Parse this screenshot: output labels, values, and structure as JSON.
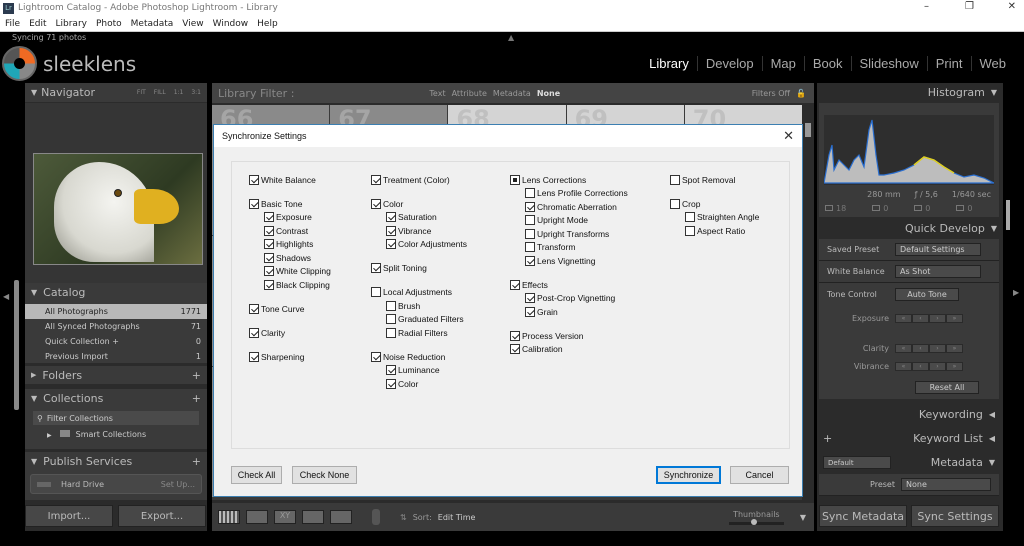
{
  "window": {
    "title": "Lightroom Catalog - Adobe Photoshop Lightroom - Library",
    "app_icon": "Lr"
  },
  "menu": [
    "File",
    "Edit",
    "Library",
    "Photo",
    "Metadata",
    "View",
    "Window",
    "Help"
  ],
  "status": "Syncing 71 photos",
  "logo": "sleeklens",
  "modules": [
    "Library",
    "Develop",
    "Map",
    "Book",
    "Slideshow",
    "Print",
    "Web"
  ],
  "left": {
    "navigator": {
      "title": "Navigator",
      "zoom": [
        "FIT",
        "FILL",
        "1:1",
        "3:1"
      ]
    },
    "catalog": {
      "title": "Catalog",
      "items": [
        {
          "label": "All Photographs",
          "count": "1771"
        },
        {
          "label": "All Synced Photographs",
          "count": "71"
        },
        {
          "label": "Quick Collection +",
          "count": "0"
        },
        {
          "label": "Previous Import",
          "count": "1"
        }
      ]
    },
    "folders": "Folders",
    "collections": {
      "title": "Collections",
      "filter": "Filter Collections",
      "smart": "Smart Collections"
    },
    "publish": {
      "title": "Publish Services",
      "service": "Hard Drive",
      "setup": "Set Up..."
    },
    "import": "Import...",
    "export": "Export..."
  },
  "filter": {
    "title": "Library Filter :",
    "tabs": [
      "Text",
      "Attribute",
      "Metadata",
      "None"
    ],
    "status": "Filters Off"
  },
  "grid": {
    "numbers": [
      "66",
      "67",
      "68",
      "69",
      "70"
    ]
  },
  "toolbar": {
    "sort_label": "Sort:",
    "sort_value": "Edit Time",
    "thumbnails": "Thumbnails",
    "thumb_level": 0.4
  },
  "right": {
    "histogram": {
      "title": "Histogram",
      "focal": "280 mm",
      "aperture": "ƒ / 5,6",
      "shutter": "1/640 sec",
      "counts": [
        "18",
        "0",
        "0",
        "0"
      ]
    },
    "quick_develop": {
      "title": "Quick Develop",
      "saved_preset_label": "Saved Preset",
      "saved_preset": "Default Settings",
      "wb_label": "White Balance",
      "wb": "As Shot",
      "tone_label": "Tone Control",
      "auto_tone": "Auto Tone",
      "exposure": "Exposure",
      "clarity": "Clarity",
      "vibrance": "Vibrance",
      "reset": "Reset All"
    },
    "keywording": "Keywording",
    "keyword_list": "Keyword List",
    "metadata": {
      "title": "Metadata",
      "preset_select": "Default",
      "preset_label": "Preset",
      "preset": "None"
    },
    "sync_metadata": "Sync Metadata",
    "sync_settings": "Sync Settings"
  },
  "dialog": {
    "title": "Synchronize Settings",
    "columns": [
      [
        [
          {
            "label": "White Balance",
            "state": "checked"
          }
        ],
        [
          {
            "label": "Basic Tone",
            "state": "checked",
            "children": [
              {
                "label": "Exposure",
                "state": "checked"
              },
              {
                "label": "Contrast",
                "state": "checked"
              },
              {
                "label": "Highlights",
                "state": "checked"
              },
              {
                "label": "Shadows",
                "state": "checked"
              },
              {
                "label": "White Clipping",
                "state": "checked"
              },
              {
                "label": "Black Clipping",
                "state": "checked"
              }
            ]
          }
        ],
        [
          {
            "label": "Tone Curve",
            "state": "checked"
          }
        ],
        [
          {
            "label": "Clarity",
            "state": "checked"
          }
        ],
        [
          {
            "label": "Sharpening",
            "state": "checked"
          }
        ]
      ],
      [
        [
          {
            "label": "Treatment (Color)",
            "state": "checked"
          }
        ],
        [
          {
            "label": "Color",
            "state": "checked",
            "children": [
              {
                "label": "Saturation",
                "state": "checked"
              },
              {
                "label": "Vibrance",
                "state": "checked"
              },
              {
                "label": "Color Adjustments",
                "state": "checked"
              }
            ]
          }
        ],
        [
          {
            "label": "Split Toning",
            "state": "checked"
          }
        ],
        [
          {
            "label": "Local Adjustments",
            "state": "unchecked",
            "children": [
              {
                "label": "Brush",
                "state": "unchecked"
              },
              {
                "label": "Graduated Filters",
                "state": "unchecked"
              },
              {
                "label": "Radial Filters",
                "state": "unchecked"
              }
            ]
          }
        ],
        [
          {
            "label": "Noise Reduction",
            "state": "checked",
            "children": [
              {
                "label": "Luminance",
                "state": "checked"
              },
              {
                "label": "Color",
                "state": "checked"
              }
            ]
          }
        ]
      ],
      [
        [
          {
            "label": "Lens Corrections",
            "state": "mixed",
            "children": [
              {
                "label": "Lens Profile Corrections",
                "state": "unchecked"
              },
              {
                "label": "Chromatic Aberration",
                "state": "checked"
              },
              {
                "label": "Upright Mode",
                "state": "unchecked"
              },
              {
                "label": "Upright Transforms",
                "state": "unchecked"
              },
              {
                "label": "Transform",
                "state": "unchecked"
              },
              {
                "label": "Lens Vignetting",
                "state": "checked"
              }
            ]
          }
        ],
        [
          {
            "label": "Effects",
            "state": "checked",
            "children": [
              {
                "label": "Post-Crop Vignetting",
                "state": "checked"
              },
              {
                "label": "Grain",
                "state": "checked"
              }
            ]
          }
        ],
        [
          {
            "label": "Process Version",
            "state": "checked"
          },
          {
            "label": "Calibration",
            "state": "checked"
          }
        ]
      ],
      [
        [
          {
            "label": "Spot Removal",
            "state": "unchecked"
          }
        ],
        [
          {
            "label": "Crop",
            "state": "unchecked",
            "children": [
              {
                "label": "Straighten Angle",
                "state": "unchecked"
              },
              {
                "label": "Aspect Ratio",
                "state": "unchecked"
              }
            ]
          }
        ]
      ]
    ],
    "check_all": "Check All",
    "check_none": "Check None",
    "synchronize": "Synchronize",
    "cancel": "Cancel"
  }
}
